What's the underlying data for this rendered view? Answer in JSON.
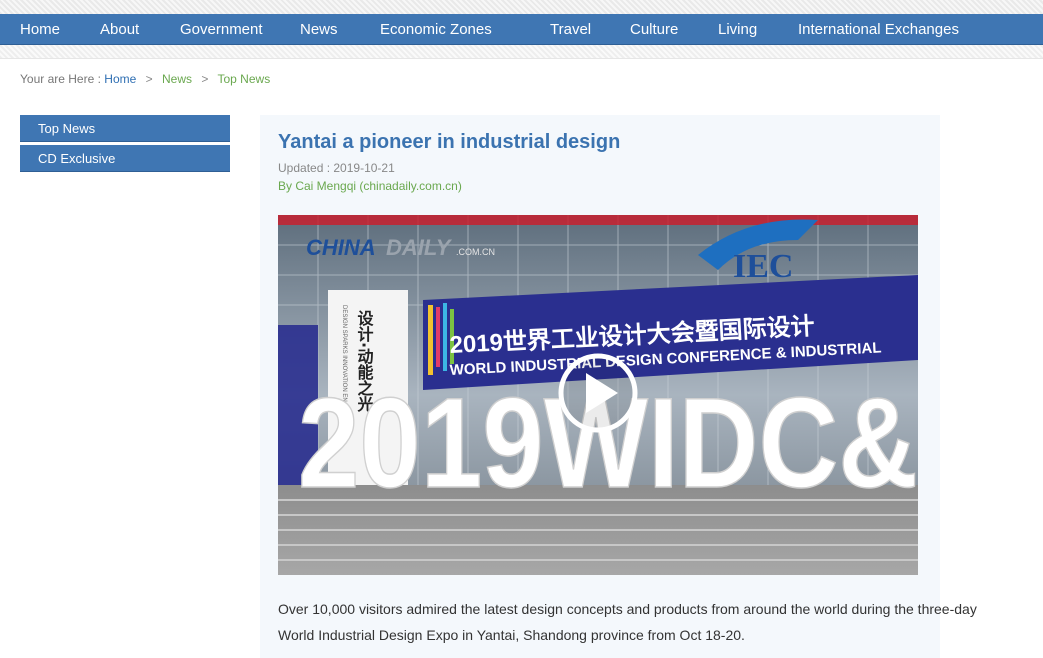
{
  "nav": {
    "items": [
      {
        "label": "Home"
      },
      {
        "label": "About"
      },
      {
        "label": "Government"
      },
      {
        "label": "News"
      },
      {
        "label": "Economic Zones"
      },
      {
        "label": "Travel"
      },
      {
        "label": "Culture"
      },
      {
        "label": "Living"
      },
      {
        "label": "International Exchanges"
      }
    ]
  },
  "breadcrumb": {
    "prefix": "Your are Here :",
    "home": "Home",
    "sep": ">",
    "news": "News",
    "current": "Top News"
  },
  "sidebar": {
    "items": [
      {
        "label": "Top News"
      },
      {
        "label": "CD Exclusive"
      }
    ]
  },
  "article": {
    "title": "Yantai a pioneer in industrial design",
    "updated": "Updated : 2019-10-21",
    "byline": "By Cai Mengqi (chinadaily.com.cn)",
    "body": "Over 10,000 visitors admired the latest design concepts and products from around the world during the three-day World Industrial Design Expo in Yantai, Shandong province from Oct 18-20."
  },
  "video": {
    "watermark_china": "CHINA",
    "watermark_daily": "DAILY",
    "watermark_com": ".COM.CN",
    "banner_cn": "2019世界工业设计大会暨国际设计",
    "banner_en": "WORLD INDUSTRIAL DESIGN CONFERENCE & INDUSTRIAL",
    "logo_text": "IEC",
    "vertical_cn": "设计·动能之光",
    "vertical_en": "DESIGN SPARKS INNOVATION EN",
    "big_letters": "2019WIDC&",
    "play_icon": "play-icon",
    "colors": {
      "banner": "#2a2f8f",
      "logo": "#1e6fc0",
      "accent_red": "#c8202f"
    }
  }
}
